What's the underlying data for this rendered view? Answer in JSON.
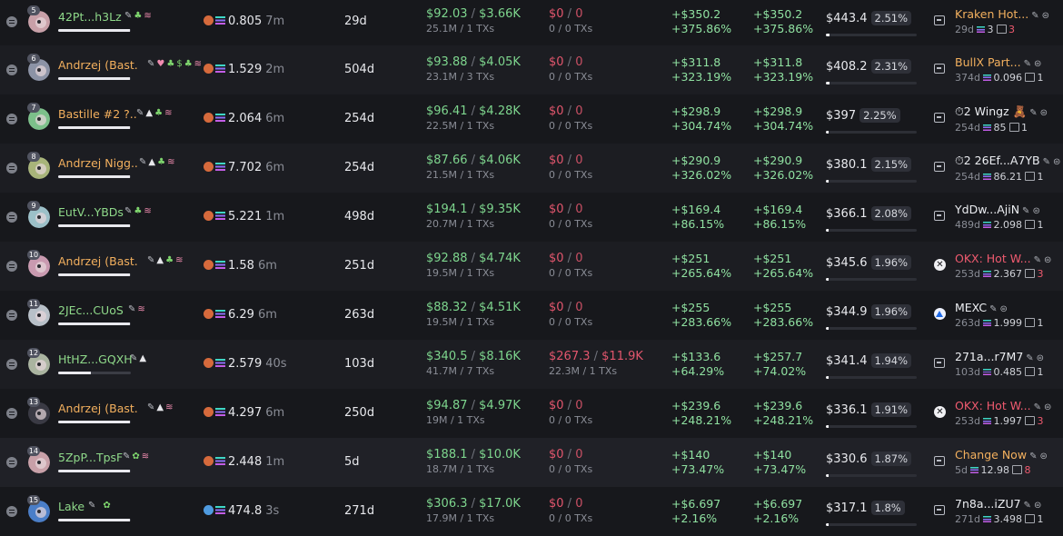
{
  "rows": [
    {
      "rank": "5",
      "name": "42Pt...h3Lz",
      "name_color": "green",
      "bar": 0.99,
      "tags": [
        "✎",
        "♣",
        "≋"
      ],
      "token": "0.805",
      "token_ago": "7m",
      "age": "29d",
      "bought_usd": "$92.03",
      "bought_total": "$3.66K",
      "bought_sub": "25.1M / 1 TXs",
      "sold_usd": "$0",
      "sold_total": "0",
      "sold_sub": "0 / 0 TXs",
      "pnl1": "+$350.2",
      "pnl1_pct": "+375.86%",
      "pnl2": "+$350.2",
      "pnl2_pct": "+375.86%",
      "remaining": "$443.4",
      "remaining_pct": "2.51%",
      "remaining_fill": 0.9,
      "fund_icon": "box",
      "fund_name": "Kraken Hot...",
      "fund_color": "orange",
      "fund_age": "29d",
      "fund_sol": "3",
      "fund_tx": "3",
      "fund_tx_red": true
    },
    {
      "rank": "6",
      "name": "Andrzej (Bast...",
      "name_color": "orange",
      "bar": 0.99,
      "tags": [
        "✎",
        "♥",
        "♣",
        "$",
        "♣",
        "≋"
      ],
      "token": "1.529",
      "token_ago": "2m",
      "age": "504d",
      "bought_usd": "$93.88",
      "bought_total": "$4.05K",
      "bought_sub": "23.1M / 3 TXs",
      "sold_usd": "$0",
      "sold_total": "0",
      "sold_sub": "0 / 0 TXs",
      "pnl1": "+$311.8",
      "pnl1_pct": "+323.19%",
      "pnl2": "+$311.8",
      "pnl2_pct": "+323.19%",
      "remaining": "$408.2",
      "remaining_pct": "2.31%",
      "remaining_fill": 0.88,
      "fund_icon": "box",
      "fund_name": "BullX Part...",
      "fund_color": "orange",
      "fund_age": "374d",
      "fund_sol": "0.096",
      "fund_tx": "1",
      "fund_tx_red": false
    },
    {
      "rank": "7",
      "name": "Bastille #2 ?...",
      "name_color": "orange",
      "bar": 0.99,
      "tags": [
        "✎",
        "▲",
        "♣",
        "≋"
      ],
      "token": "2.064",
      "token_ago": "6m",
      "age": "254d",
      "bought_usd": "$96.41",
      "bought_total": "$4.28K",
      "bought_sub": "22.5M / 1 TXs",
      "sold_usd": "$0",
      "sold_total": "0",
      "sold_sub": "0 / 0 TXs",
      "pnl1": "+$298.9",
      "pnl1_pct": "+304.74%",
      "pnl2": "+$298.9",
      "pnl2_pct": "+304.74%",
      "remaining": "$397",
      "remaining_pct": "2.25%",
      "remaining_fill": 0.87,
      "fund_icon": "box",
      "fund_name": "⏱2 Wingz 🧸",
      "fund_color": "white",
      "fund_age": "254d",
      "fund_sol": "85",
      "fund_tx": "1",
      "fund_tx_red": false
    },
    {
      "rank": "8",
      "name": "Andrzej Nigg...",
      "name_color": "orange",
      "bar": 0.99,
      "tags": [
        "✎",
        "▲",
        "♣",
        "≋"
      ],
      "token": "7.702",
      "token_ago": "6m",
      "age": "254d",
      "bought_usd": "$87.66",
      "bought_total": "$4.06K",
      "bought_sub": "21.5M / 1 TXs",
      "sold_usd": "$0",
      "sold_total": "0",
      "sold_sub": "0 / 0 TXs",
      "pnl1": "+$290.9",
      "pnl1_pct": "+326.02%",
      "pnl2": "+$290.9",
      "pnl2_pct": "+326.02%",
      "remaining": "$380.1",
      "remaining_pct": "2.15%",
      "remaining_fill": 0.86,
      "fund_icon": "box",
      "fund_name": "⏱2 26Ef...A7YB",
      "fund_color": "white",
      "fund_age": "254d",
      "fund_sol": "86.21",
      "fund_tx": "1",
      "fund_tx_red": false
    },
    {
      "rank": "9",
      "name": "EutV...YBDs",
      "name_color": "green",
      "bar": 0.99,
      "tags": [
        "✎",
        "♣",
        "≋"
      ],
      "token": "5.221",
      "token_ago": "1m",
      "age": "498d",
      "bought_usd": "$194.1",
      "bought_total": "$9.35K",
      "bought_sub": "20.7M / 1 TXs",
      "sold_usd": "$0",
      "sold_total": "0",
      "sold_sub": "0 / 0 TXs",
      "pnl1": "+$169.4",
      "pnl1_pct": "+86.15%",
      "pnl2": "+$169.4",
      "pnl2_pct": "+86.15%",
      "remaining": "$366.1",
      "remaining_pct": "2.08%",
      "remaining_fill": 0.85,
      "fund_icon": "box",
      "fund_name": "YdDw...AjiN",
      "fund_color": "white",
      "fund_age": "489d",
      "fund_sol": "2.098",
      "fund_tx": "1",
      "fund_tx_red": false
    },
    {
      "rank": "10",
      "name": "Andrzej (Bast...",
      "name_color": "orange",
      "bar": 0.99,
      "tags": [
        "✎",
        "▲",
        "♣",
        "≋"
      ],
      "token": "1.58",
      "token_ago": "6m",
      "age": "251d",
      "bought_usd": "$92.88",
      "bought_total": "$4.74K",
      "bought_sub": "19.5M / 1 TXs",
      "sold_usd": "$0",
      "sold_total": "0",
      "sold_sub": "0 / 0 TXs",
      "pnl1": "+$251",
      "pnl1_pct": "+265.64%",
      "pnl2": "+$251",
      "pnl2_pct": "+265.64%",
      "remaining": "$345.6",
      "remaining_pct": "1.96%",
      "remaining_fill": 0.84,
      "fund_icon": "x",
      "fund_name": "OKX: Hot W...",
      "fund_color": "red",
      "fund_age": "253d",
      "fund_sol": "2.367",
      "fund_tx": "3",
      "fund_tx_red": true
    },
    {
      "rank": "11",
      "name": "2JEc...CUoS",
      "name_color": "green",
      "bar": 0.99,
      "tags": [
        "✎",
        "≋"
      ],
      "token": "6.29",
      "token_ago": "6m",
      "age": "263d",
      "bought_usd": "$88.32",
      "bought_total": "$4.51K",
      "bought_sub": "19.5M / 1 TXs",
      "sold_usd": "$0",
      "sold_total": "0",
      "sold_sub": "0 / 0 TXs",
      "pnl1": "+$255",
      "pnl1_pct": "+283.66%",
      "pnl2": "+$255",
      "pnl2_pct": "+283.66%",
      "remaining": "$344.9",
      "remaining_pct": "1.96%",
      "remaining_fill": 0.84,
      "fund_icon": "mexc",
      "fund_name": "MEXC",
      "fund_color": "white",
      "fund_age": "263d",
      "fund_sol": "1.999",
      "fund_tx": "1",
      "fund_tx_red": false
    },
    {
      "rank": "12",
      "name": "HtHZ...GQXH",
      "name_color": "green",
      "bar": 0.45,
      "tags": [
        "✎",
        "▲"
      ],
      "token": "2.579",
      "token_ago": "40s",
      "age": "103d",
      "bought_usd": "$340.5",
      "bought_total": "$8.16K",
      "bought_sub": "41.7M / 7 TXs",
      "sold_usd": "$267.3",
      "sold_total": "$11.9K",
      "sold_sub": "22.3M / 1 TXs",
      "pnl1": "+$133.6",
      "pnl1_pct": "+64.29%",
      "pnl2": "+$257.7",
      "pnl2_pct": "+74.02%",
      "remaining": "$341.4",
      "remaining_pct": "1.94%",
      "remaining_fill": 0.83,
      "fund_icon": "box",
      "fund_name": "271a...r7M7",
      "fund_color": "white",
      "fund_age": "103d",
      "fund_sol": "0.485",
      "fund_tx": "1",
      "fund_tx_red": false
    },
    {
      "rank": "13",
      "name": "Andrzej (Bast...",
      "name_color": "orange",
      "bar": 0.99,
      "tags": [
        "✎",
        "▲",
        "≋"
      ],
      "token": "4.297",
      "token_ago": "6m",
      "age": "250d",
      "bought_usd": "$94.87",
      "bought_total": "$4.97K",
      "bought_sub": "19M / 1 TXs",
      "sold_usd": "$0",
      "sold_total": "0",
      "sold_sub": "0 / 0 TXs",
      "pnl1": "+$239.6",
      "pnl1_pct": "+248.21%",
      "pnl2": "+$239.6",
      "pnl2_pct": "+248.21%",
      "remaining": "$336.1",
      "remaining_pct": "1.91%",
      "remaining_fill": 0.82,
      "fund_icon": "x",
      "fund_name": "OKX: Hot W...",
      "fund_color": "red",
      "fund_age": "253d",
      "fund_sol": "1.997",
      "fund_tx": "3",
      "fund_tx_red": true
    },
    {
      "rank": "14",
      "name": "5ZpP...TpsF",
      "name_color": "green",
      "bar": 0.99,
      "tags": [
        "✎",
        "✿",
        "≋"
      ],
      "token": "2.448",
      "token_ago": "1m",
      "age": "5d",
      "bought_usd": "$188.1",
      "bought_total": "$10.0K",
      "bought_sub": "18.7M / 1 TXs",
      "sold_usd": "$0",
      "sold_total": "0",
      "sold_sub": "0 / 0 TXs",
      "pnl1": "+$140",
      "pnl1_pct": "+73.47%",
      "pnl2": "+$140",
      "pnl2_pct": "+73.47%",
      "remaining": "$330.6",
      "remaining_pct": "1.87%",
      "remaining_fill": 0.8,
      "fund_icon": "box",
      "fund_name": "Change Now",
      "fund_color": "orange",
      "fund_age": "5d",
      "fund_sol": "12.98",
      "fund_tx": "8",
      "fund_tx_red": true
    },
    {
      "rank": "15",
      "name": "Lake",
      "name_color": "green",
      "bar": 0.99,
      "tags": [
        "✎",
        "",
        "",
        "",
        "✿"
      ],
      "token": "474.8",
      "token_ago": "3s",
      "age": "271d",
      "bought_usd": "$306.3",
      "bought_total": "$17.0K",
      "bought_sub": "17.9M / 1 TXs",
      "sold_usd": "$0",
      "sold_total": "0",
      "sold_sub": "0 / 0 TXs",
      "pnl1": "+$6.697",
      "pnl1_pct": "+2.16%",
      "pnl2": "+$6.697",
      "pnl2_pct": "+2.16%",
      "remaining": "$317.1",
      "remaining_pct": "1.8%",
      "remaining_fill": 0.78,
      "fund_icon": "box",
      "fund_name": "7n8a...iZU7",
      "fund_color": "white",
      "fund_age": "271d",
      "fund_sol": "3.498",
      "fund_tx": "1",
      "fund_tx_red": false
    }
  ]
}
